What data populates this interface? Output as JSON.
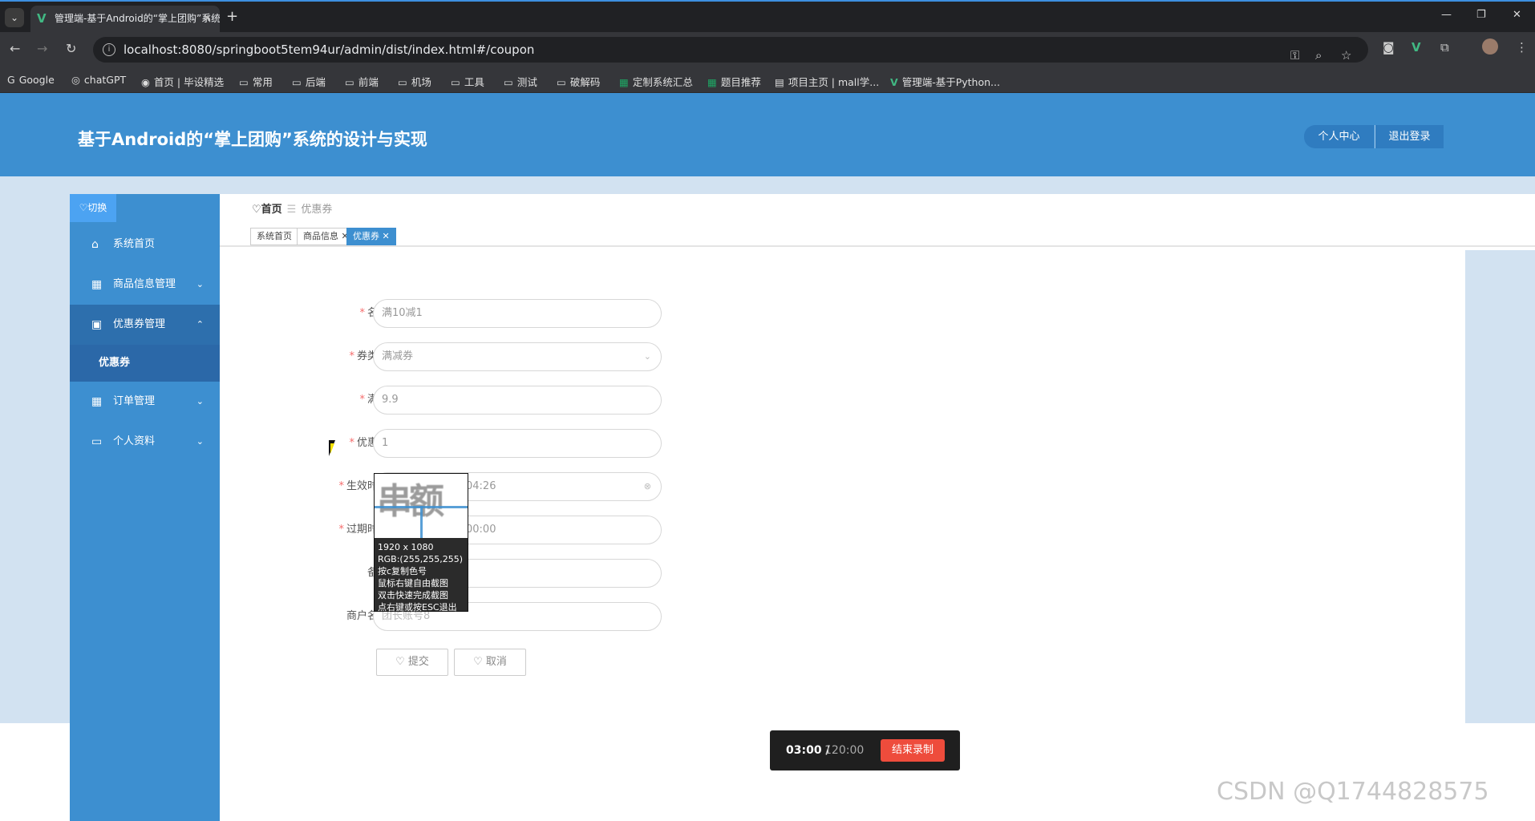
{
  "browser": {
    "tab_title": "管理端-基于Android的“掌上团购”系统的设计与实现",
    "tab_close": "✕",
    "new_tab": "+",
    "url": "localhost:8080/springboot5tem94ur/admin/dist/index.html#/coupon",
    "bookmarks": [
      {
        "label": "Google",
        "icon": "google-icon"
      },
      {
        "label": "chatGPT",
        "icon": "chatgpt-icon"
      },
      {
        "label": "首页 | 毕设精选",
        "icon": "site-icon"
      },
      {
        "label": "常用",
        "icon": "folder-icon"
      },
      {
        "label": "后端",
        "icon": "folder-icon"
      },
      {
        "label": "前端",
        "icon": "folder-icon"
      },
      {
        "label": "机场",
        "icon": "folder-icon"
      },
      {
        "label": "工具",
        "icon": "folder-icon"
      },
      {
        "label": "测试",
        "icon": "folder-icon"
      },
      {
        "label": "破解码",
        "icon": "folder-icon"
      },
      {
        "label": "定制系统汇总",
        "icon": "sheet-icon"
      },
      {
        "label": "题目推荐",
        "icon": "sheet-icon"
      },
      {
        "label": "项目主页 | mall学...",
        "icon": "site-icon"
      },
      {
        "label": "管理端-基于Python...",
        "icon": "vue-icon"
      }
    ]
  },
  "header": {
    "title": "基于Android的“掌上团购”系统的设计与实现",
    "profile_button": "个人中心",
    "logout_button": "退出登录"
  },
  "sidebar": {
    "toggle_label": "♡切换",
    "items": [
      {
        "label": "系统首页",
        "icon": "home-icon"
      },
      {
        "label": "商品信息管理",
        "icon": "grid-icon"
      },
      {
        "label": "优惠券管理",
        "icon": "clipboard-icon"
      },
      {
        "label": "订单管理",
        "icon": "grid-icon"
      },
      {
        "label": "个人资料",
        "icon": "card-icon"
      }
    ],
    "subitem": "优惠券"
  },
  "breadcrumb": {
    "home": "♡首页",
    "separator": "☰",
    "current": "优惠券"
  },
  "tags": [
    {
      "label": "系统首页"
    },
    {
      "label": "商品信息 ✕"
    },
    {
      "label": "优惠券 ✕"
    }
  ],
  "form": {
    "fields": [
      {
        "label": "名称",
        "required": true,
        "value": "满10减1"
      },
      {
        "label": "券类型",
        "required": true,
        "value": "满减券"
      },
      {
        "label": "满额",
        "required": true,
        "value": "9.9"
      },
      {
        "label": "优惠额",
        "required": true,
        "value": "1"
      },
      {
        "label": "生效时间",
        "required": true,
        "value": "04:26"
      },
      {
        "label": "过期时间",
        "required": true,
        "value": "00:00"
      },
      {
        "label": "备注",
        "required": false,
        "value": ""
      },
      {
        "label": "商户名称",
        "required": false,
        "value": "团长账号8"
      }
    ],
    "required_mark": "*",
    "submit_label": "♡ 提交",
    "cancel_label": "♡ 取消"
  },
  "magnifier": {
    "preview_text": "串额",
    "lines": [
      "1920 x 1080",
      "RGB:(255,255,255)",
      "按c复制色号",
      "鼠标右键自由截图",
      "双击快速完成截图",
      "点右键或按ESC退出"
    ]
  },
  "recording": {
    "elapsed": "03:00 /",
    "total": "120:00",
    "stop_label": "结束录制"
  },
  "watermark": "CSDN @Q1744828575",
  "colors": {
    "brand": "#3d8fd0",
    "sidebar_active": "#2b68a8",
    "required": "#f56c6c",
    "record_stop": "#ee4c3c"
  }
}
